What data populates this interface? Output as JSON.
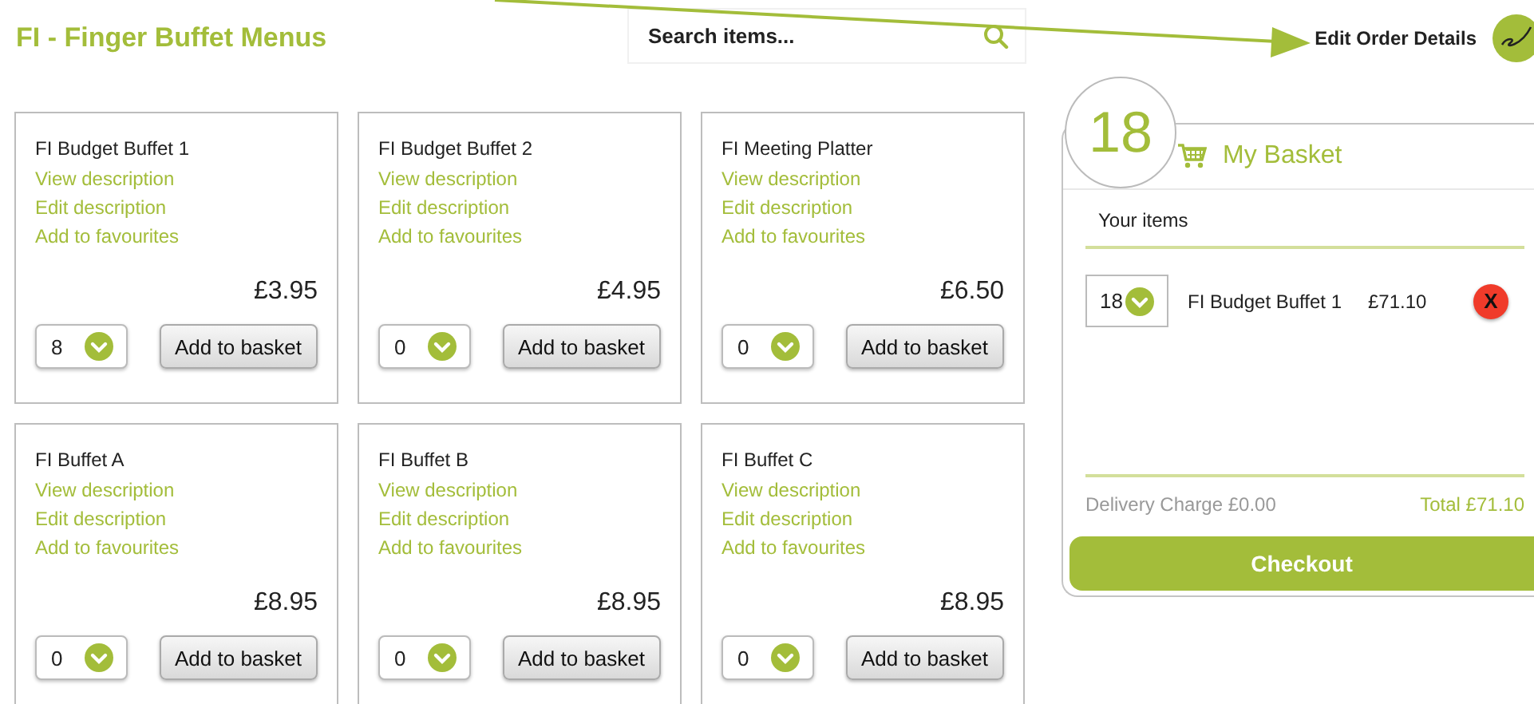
{
  "header": {
    "title": "FI - Finger Buffet Menus",
    "search": {
      "placeholder": "Search items..."
    },
    "edit_order": "Edit Order Details"
  },
  "products": [
    {
      "name": "FI Budget Buffet 1",
      "links": [
        "View description",
        "Edit description",
        "Add to favourites"
      ],
      "price": "£3.95",
      "quantity": "8",
      "button": "Add to basket"
    },
    {
      "name": "FI Budget Buffet 2",
      "links": [
        "View description",
        "Edit description",
        "Add to favourites"
      ],
      "price": "£4.95",
      "quantity": "0",
      "button": "Add to basket"
    },
    {
      "name": "FI Meeting Platter",
      "links": [
        "View description",
        "Edit description",
        "Add to favourites"
      ],
      "price": "£6.50",
      "quantity": "0",
      "button": "Add to basket"
    },
    {
      "name": "FI Buffet A",
      "links": [
        "View description",
        "Edit description",
        "Add to favourites"
      ],
      "price": "£8.95",
      "quantity": "0",
      "button": "Add to basket"
    },
    {
      "name": "FI Buffet B",
      "links": [
        "View description",
        "Edit description",
        "Add to favourites"
      ],
      "price": "£8.95",
      "quantity": "0",
      "button": "Add to basket"
    },
    {
      "name": "FI Buffet C",
      "links": [
        "View description",
        "Edit description",
        "Add to favourites"
      ],
      "price": "£8.95",
      "quantity": "0",
      "button": "Add to basket"
    }
  ],
  "basket": {
    "count": "18",
    "title": "My Basket",
    "subheading": "Your items",
    "items": [
      {
        "quantity": "18",
        "name": "FI Budget Buffet 1",
        "price": "£71.10",
        "remove": "X"
      }
    ],
    "delivery": "Delivery Charge £0.00",
    "total": "Total £71.10",
    "checkout": "Checkout"
  }
}
